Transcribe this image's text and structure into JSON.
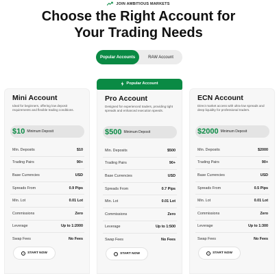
{
  "eyebrow": {
    "icon": "trend-arrow-icon",
    "text": "JOIN AMBITIOUS MARKETS"
  },
  "headline": {
    "line1": "Choose the Right Account for",
    "line2": "Your Trading Needs"
  },
  "tabs": [
    {
      "label": "Popular Accounts",
      "active": true
    },
    {
      "label": "RAW Account",
      "active": false
    }
  ],
  "badge": {
    "icon": "lightning-icon",
    "text": "Popular Account"
  },
  "accent_color": "#0a8a44",
  "cards": [
    {
      "title": "Mini Account",
      "description": "Ideal for beginners, offering low deposit requirements and flexible trading conditions.",
      "price": "$10",
      "price_label": "Minimum Deposit",
      "rows": [
        {
          "k": "Min. Deposits",
          "v": "$10"
        },
        {
          "k": "Trading Pairs",
          "v": "90+"
        },
        {
          "k": "Base Currencies",
          "v": "USD"
        },
        {
          "k": "Spreads From",
          "v": "0.9 Pips"
        },
        {
          "k": "Min. Lot",
          "v": "0.01 Lot"
        },
        {
          "k": "Commissions",
          "v": "Zero"
        },
        {
          "k": "Leverage",
          "v": "Up to 1:2000"
        },
        {
          "k": "Swap Fees",
          "v": "No Fees"
        }
      ],
      "button": "START NOW"
    },
    {
      "title": "Pro Account",
      "description": "Designed for experienced traders, providing tight spreads and enhanced execution speeds.",
      "price": "$500",
      "price_label": "Minimum Deposit",
      "rows": [
        {
          "k": "Min. Deposits",
          "v": "$500"
        },
        {
          "k": "Trading Pairs",
          "v": "90+"
        },
        {
          "k": "Base Currencies",
          "v": "USD"
        },
        {
          "k": "Spreads From",
          "v": "0.7 Pips"
        },
        {
          "k": "Min. Lot",
          "v": "0.01 Lot"
        },
        {
          "k": "Commissions",
          "v": "Zero"
        },
        {
          "k": "Leverage",
          "v": "Up to 1:500"
        },
        {
          "k": "Swap Fees",
          "v": "No Fees"
        }
      ],
      "button": "START NOW"
    },
    {
      "title": "ECN Account",
      "description": "Direct market access with ultra-low spreads and deep liquidity for professional traders.",
      "price": "$2000",
      "price_label": "Minimum Deposit",
      "rows": [
        {
          "k": "Min. Deposits",
          "v": "$2000"
        },
        {
          "k": "Trading Pairs",
          "v": "90+"
        },
        {
          "k": "Base Currencies",
          "v": "USD"
        },
        {
          "k": "Spreads From",
          "v": "0.5 Pips"
        },
        {
          "k": "Min. Lot",
          "v": "0.01 Lot"
        },
        {
          "k": "Commissions",
          "v": "Zero"
        },
        {
          "k": "Leverage",
          "v": "Up to 1:300"
        },
        {
          "k": "Swap Fees",
          "v": "No Fees"
        }
      ],
      "button": "START NOW"
    }
  ]
}
